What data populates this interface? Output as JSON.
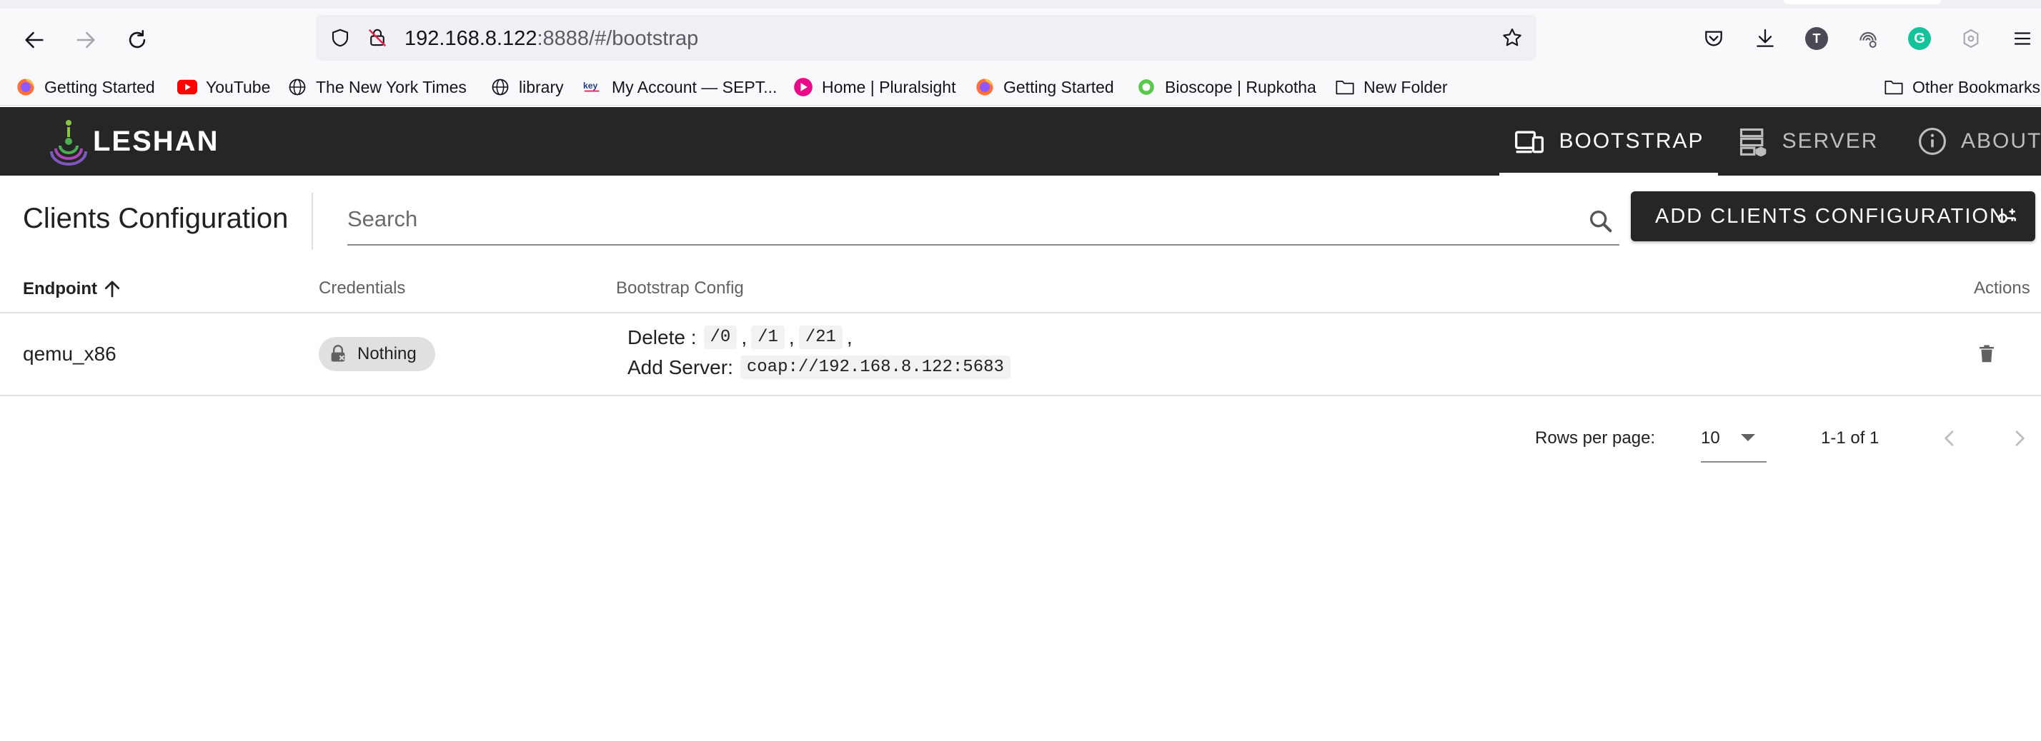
{
  "browser": {
    "url_host": "192.168.8.122",
    "url_rest": ":8888/#/bootstrap",
    "bookmarks": [
      {
        "label": "Getting Started",
        "icon": "firefox-icon"
      },
      {
        "label": "YouTube",
        "icon": "youtube-icon"
      },
      {
        "label": "The New York Times",
        "icon": "globe-icon"
      },
      {
        "label": "library",
        "icon": "globe-icon"
      },
      {
        "label": "My Account — SEPT...",
        "icon": "key-icon"
      },
      {
        "label": "Home | Pluralsight",
        "icon": "pluralsight-icon"
      },
      {
        "label": "Getting Started",
        "icon": "firefox-icon"
      },
      {
        "label": "Bioscope | Rupkotha",
        "icon": "bioscope-icon"
      },
      {
        "label": "New Folder",
        "icon": "folder-icon"
      }
    ],
    "other_bookmarks": "Other Bookmarks",
    "profile_initial": "T",
    "grammarly_initial": "G"
  },
  "app": {
    "logo_text": "LESHAN",
    "nav": [
      {
        "label": "BOOTSTRAP",
        "icon": "devices-icon",
        "active": true
      },
      {
        "label": "SERVER",
        "icon": "server-icon",
        "active": false
      },
      {
        "label": "ABOUT",
        "icon": "info-icon",
        "active": false
      }
    ]
  },
  "page": {
    "title": "Clients Configuration",
    "search_placeholder": "Search",
    "add_button": "ADD CLIENTS CONFIGURATION"
  },
  "table": {
    "columns": {
      "endpoint": "Endpoint",
      "credentials": "Credentials",
      "bootstrap_config": "Bootstrap Config",
      "actions": "Actions"
    },
    "sort": {
      "column": "Endpoint",
      "direction": "ascending"
    },
    "rows": [
      {
        "endpoint": "qemu_x86",
        "credentials": "Nothing",
        "delete_label": "Delete :",
        "delete_paths": [
          "/0",
          "/1",
          "/21"
        ],
        "add_server_label": "Add Server:",
        "add_server_uri": "coap://192.168.8.122:5683"
      }
    ]
  },
  "pagination": {
    "rows_per_page_label": "Rows per page:",
    "rows_per_page": "10",
    "range": "1-1 of 1"
  },
  "colors": {
    "appbar": "#262626",
    "chip": "#e0e0e0",
    "code_bg": "#f2f2f2"
  }
}
